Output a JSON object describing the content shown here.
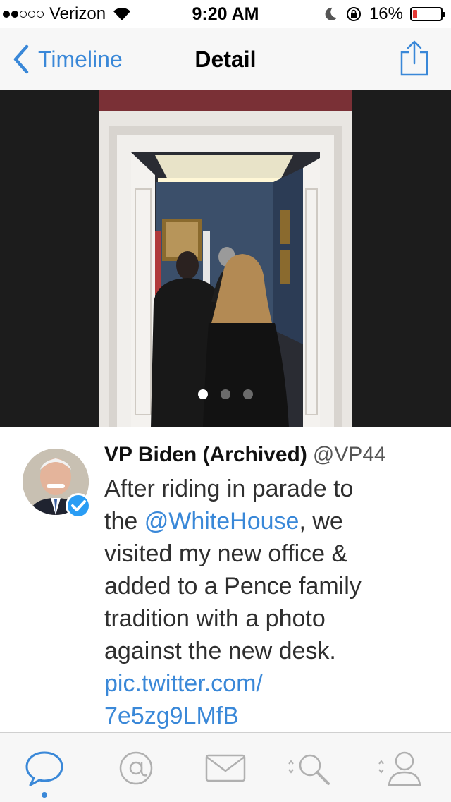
{
  "status_bar": {
    "carrier": "Verizon",
    "time": "9:20 AM",
    "battery": "16%"
  },
  "nav": {
    "back_label": "Timeline",
    "title": "Detail"
  },
  "photo": {
    "page_count": 3,
    "current_page": 1
  },
  "tweet": {
    "author_name": "VP Biden (Archived)",
    "handle": "@VP44",
    "text_lines": [
      "After riding in parade to",
      "the ",
      "@WhiteHouse",
      ", we",
      "visited my new office &",
      "added to a Pence family",
      "tradition with a photo",
      "against the new desk.",
      "pic.twitter.com/",
      "7e5zg9LMfB"
    ]
  },
  "tabs": [
    {
      "name": "timeline-tab",
      "icon": "chat-bubble-icon"
    },
    {
      "name": "mentions-tab",
      "icon": "at-sign-icon"
    },
    {
      "name": "messages-tab",
      "icon": "envelope-icon"
    },
    {
      "name": "search-tab",
      "icon": "search-icon"
    },
    {
      "name": "profile-tab",
      "icon": "profile-icon"
    }
  ],
  "colors": {
    "accent": "#3a88d8",
    "battery_low": "#e53935"
  }
}
